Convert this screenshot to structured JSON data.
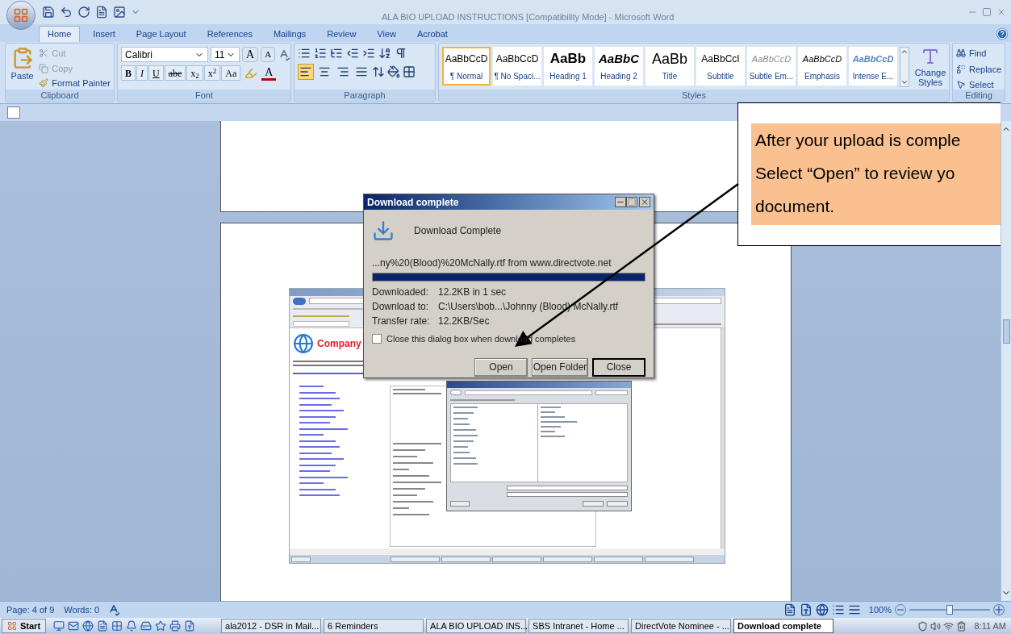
{
  "window": {
    "title": "ALA BIO UPLOAD INSTRUCTIONS [Compatibility Mode] - Microsoft Word"
  },
  "ribbon_tabs": [
    {
      "label": "Home",
      "selected": true
    },
    {
      "label": "Insert",
      "selected": false
    },
    {
      "label": "Page Layout",
      "selected": false
    },
    {
      "label": "References",
      "selected": false
    },
    {
      "label": "Mailings",
      "selected": false
    },
    {
      "label": "Review",
      "selected": false
    },
    {
      "label": "View",
      "selected": false
    },
    {
      "label": "Acrobat",
      "selected": false
    }
  ],
  "clipboard": {
    "paste": "Paste",
    "cut": "Cut",
    "copy": "Copy",
    "format_painter": "Format Painter",
    "group": "Clipboard"
  },
  "font": {
    "name": "Calibri",
    "size": "11",
    "size_buttons": [
      "A",
      "A"
    ],
    "format_buttons": [
      "B",
      "I",
      "U",
      "abe",
      "x$_{2}$",
      "x$^{2}$",
      "Aa"
    ],
    "color_button": "A",
    "group": "Font"
  },
  "paragraph": {
    "alignment": [
      {
        "kind": "left",
        "selected": true
      },
      {
        "kind": "center",
        "selected": false
      },
      {
        "kind": "right",
        "selected": false
      },
      {
        "kind": "justify",
        "selected": false
      }
    ],
    "group": "Paragraph"
  },
  "styles": {
    "items": [
      {
        "preview": "AaBbCcD",
        "label": "¶ Normal",
        "kind": "normal",
        "selected": true
      },
      {
        "preview": "AaBbCcD",
        "label": "¶ No Spaci...",
        "kind": "normal",
        "selected": false
      },
      {
        "preview": "AaBb",
        "label": "Heading 1",
        "kind": "heading1",
        "selected": false
      },
      {
        "preview": "AaBbC",
        "label": "Heading 2",
        "kind": "heading2",
        "selected": false
      },
      {
        "preview": "AaBb",
        "label": "Title",
        "kind": "title",
        "selected": false
      },
      {
        "preview": "AaBbCcI",
        "label": "Subtitle",
        "kind": "subtitle",
        "selected": false
      },
      {
        "preview": "AaBbCcD",
        "label": "Subtle Em...",
        "kind": "subtle",
        "selected": false
      },
      {
        "preview": "AaBbCcD",
        "label": "Emphasis",
        "kind": "emphasis",
        "selected": false
      },
      {
        "preview": "AaBbCcD",
        "label": "Intense E...",
        "kind": "intense",
        "selected": false
      }
    ],
    "change_styles": "Change Styles",
    "group": "Styles"
  },
  "editing": {
    "find": "Find",
    "replace": "Replace",
    "select": "Select",
    "group": "Editing"
  },
  "callout": {
    "lines": [
      "After your upload is comple",
      "Select “Open” to review yo",
      "document."
    ]
  },
  "dialog": {
    "title": "Download complete",
    "heading": "Download Complete",
    "source": "...ny%20(Blood)%20McNally.rtf from www.directvote.net",
    "progress": {
      "level": 1
    },
    "rows": [
      {
        "label": "Downloaded:",
        "value": "12.2KB in 1 sec"
      },
      {
        "label": "Download to:",
        "value": "C:\\Users\\bob...\\Johnny (Blood) McNally.rtf"
      },
      {
        "label": "Transfer rate:",
        "value": "12.2KB/Sec"
      }
    ],
    "close_when_done": {
      "label": "Close this dialog box when download completes",
      "checked": false
    },
    "buttons": [
      {
        "label": "Open",
        "default": false
      },
      {
        "label": "Open Folder",
        "default": false
      },
      {
        "label": "Close",
        "default": true
      }
    ]
  },
  "embedded_screenshot": {
    "logo": "Company"
  },
  "status_bar": {
    "page": "Page: 4 of 9",
    "words": "Words: 0",
    "zoom": "100%",
    "zoom_slider": {
      "level": 0.5
    }
  },
  "taskbar": {
    "start": "Start",
    "tasks": [
      {
        "label": "ala2012 - DSR in Mail...",
        "selected": false
      },
      {
        "label": "6 Reminders",
        "selected": false
      },
      {
        "label": "ALA BIO UPLOAD INS...",
        "selected": false
      },
      {
        "label": "SBS Intranet - Home ...",
        "selected": false
      },
      {
        "label": "DirectVote Nominee - ...",
        "selected": false
      },
      {
        "label": "Download complete",
        "selected": true
      }
    ],
    "clock": "8:11 AM"
  }
}
